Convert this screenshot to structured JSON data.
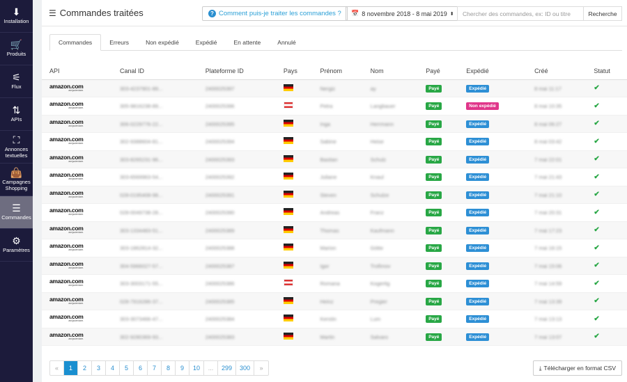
{
  "sidebar": {
    "items": [
      {
        "label": "Installation",
        "icon": "download-icon",
        "glyph": "⬇"
      },
      {
        "label": "Produits",
        "icon": "cart-icon",
        "glyph": "🛒"
      },
      {
        "label": "Flux",
        "icon": "sliders-icon",
        "glyph": "⚟"
      },
      {
        "label": "APIs",
        "icon": "arrows-updown-icon",
        "glyph": "⇅"
      },
      {
        "label": "Annonces textuelles",
        "icon": "expand-icon",
        "glyph": "⛶"
      },
      {
        "label": "Campagnes Shopping",
        "icon": "shopping-bag-icon",
        "glyph": "👜"
      },
      {
        "label": "Commandes",
        "icon": "list-icon",
        "glyph": "☰",
        "active": true
      },
      {
        "label": "Paramètres",
        "icon": "gear-icon",
        "glyph": "⚙"
      }
    ]
  },
  "header": {
    "title": "Commandes traitées",
    "help_label": "Comment puis-je traiter les commandes ?",
    "date_range": "8 novembre 2018 - 8 mai 2019",
    "search_placeholder": "Chercher des commandes, ex: ID ou titre",
    "search_button": "Recherche"
  },
  "tabs": [
    {
      "label": "Commandes",
      "active": true
    },
    {
      "label": "Erreurs"
    },
    {
      "label": "Non expédié"
    },
    {
      "label": "Expédié"
    },
    {
      "label": "En attente"
    },
    {
      "label": "Annulé"
    }
  ],
  "table": {
    "columns": [
      "API",
      "Canal ID",
      "Plateforme ID",
      "Pays",
      "Prénom",
      "Nom",
      "Payé",
      "Expédié",
      "Créé",
      "Statut"
    ],
    "api_logo": "amazon.com",
    "api_tagline": "and you're done.",
    "colors": {
      "paid": "#28a745",
      "shipped": "#2d8fd5",
      "not_shipped": "#e0368a",
      "status_ok": "#28a745"
    },
    "rows": [
      {
        "canal": "303-4237901-89...",
        "plateforme": "2400025397",
        "pays": "DE",
        "prenom": "Nergiz",
        "nom": "ay",
        "paye": "Payé",
        "expedie": "Expédié",
        "cree": "8 mai 11:17"
      },
      {
        "canal": "305-9816238-89...",
        "plateforme": "2400025396",
        "pays": "AT",
        "prenom": "Petra",
        "nom": "Langbauer",
        "paye": "Payé",
        "expedie": "Non expédié",
        "cree": "8 mai 10:35"
      },
      {
        "canal": "306-0229776-22...",
        "plateforme": "2400025395",
        "pays": "DE",
        "prenom": "Inga",
        "nom": "Herrmann",
        "paye": "Payé",
        "expedie": "Expédié",
        "cree": "8 mai 06:27"
      },
      {
        "canal": "302-9388604-81...",
        "plateforme": "2400025394",
        "pays": "DE",
        "prenom": "Sabine",
        "nom": "Heise",
        "paye": "Payé",
        "expedie": "Expédié",
        "cree": "8 mai 03:42"
      },
      {
        "canal": "303-8265231-96...",
        "plateforme": "2400025393",
        "pays": "DE",
        "prenom": "Bastian",
        "nom": "Schulz",
        "paye": "Payé",
        "expedie": "Expédié",
        "cree": "7 mai 22:01"
      },
      {
        "canal": "303-6569963-54...",
        "plateforme": "2400025392",
        "pays": "DE",
        "prenom": "Juliane",
        "nom": "Knaul",
        "paye": "Payé",
        "expedie": "Expédié",
        "cree": "7 mai 21:43"
      },
      {
        "canal": "028-0195408-98...",
        "plateforme": "2400025391",
        "pays": "DE",
        "prenom": "Steven",
        "nom": "Schulze",
        "paye": "Payé",
        "expedie": "Expédié",
        "cree": "7 mai 21:10"
      },
      {
        "canal": "028-0049738-28...",
        "plateforme": "2400025390",
        "pays": "DE",
        "prenom": "Andreas",
        "nom": "Franz",
        "paye": "Payé",
        "expedie": "Expédié",
        "cree": "7 mai 20:31"
      },
      {
        "canal": "303-1334483-51...",
        "plateforme": "2400025389",
        "pays": "DE",
        "prenom": "Thomas",
        "nom": "Kaufmann",
        "paye": "Payé",
        "expedie": "Expédié",
        "cree": "7 mai 17:23"
      },
      {
        "canal": "303-1862814-32...",
        "plateforme": "2400025388",
        "pays": "DE",
        "prenom": "Marion",
        "nom": "Götte",
        "paye": "Payé",
        "expedie": "Expédié",
        "cree": "7 mai 16:15"
      },
      {
        "canal": "304-5966027-57...",
        "plateforme": "2400025387",
        "pays": "DE",
        "prenom": "Igor",
        "nom": "Trofimov",
        "paye": "Payé",
        "expedie": "Expédié",
        "cree": "7 mai 15:06"
      },
      {
        "canal": "303-3003171-55...",
        "plateforme": "2400025386",
        "pays": "AT",
        "prenom": "Romana",
        "nom": "Kogertig",
        "paye": "Payé",
        "expedie": "Expédié",
        "cree": "7 mai 14:59"
      },
      {
        "canal": "028-7916286-37...",
        "plateforme": "2400025385",
        "pays": "DE",
        "prenom": "Heinz",
        "nom": "Pregier",
        "paye": "Payé",
        "expedie": "Expédié",
        "cree": "7 mai 13:39"
      },
      {
        "canal": "303-3073466-47...",
        "plateforme": "2400025384",
        "pays": "DE",
        "prenom": "Kerstin",
        "nom": "Lum",
        "paye": "Payé",
        "expedie": "Expédié",
        "cree": "7 mai 13:13"
      },
      {
        "canal": "302-9280369-93...",
        "plateforme": "2400025383",
        "pays": "DE",
        "prenom": "Martin",
        "nom": "Salvaro",
        "paye": "Payé",
        "expedie": "Expédié",
        "cree": "7 mai 13:07"
      }
    ]
  },
  "pagination": {
    "prev": "«",
    "pages": [
      "1",
      "2",
      "3",
      "4",
      "5",
      "6",
      "7",
      "8",
      "9",
      "10",
      "...",
      "299",
      "300"
    ],
    "current": "1",
    "next": "»"
  },
  "csv_button": "Télécharger en format CSV"
}
